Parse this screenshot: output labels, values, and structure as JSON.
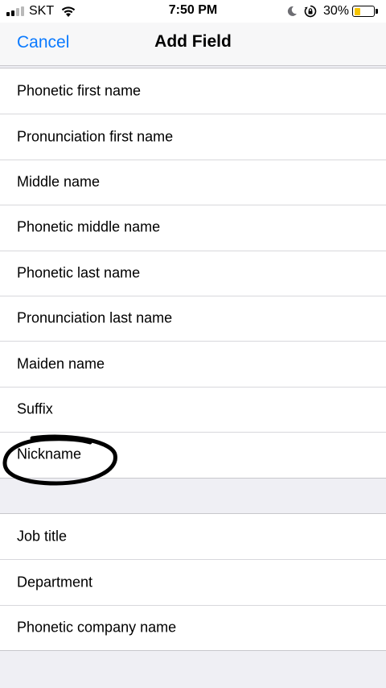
{
  "status_bar": {
    "carrier": "SKT",
    "time": "7:50 PM",
    "battery_percent": "30%",
    "battery_level": 0.3,
    "signal_bars": 2,
    "battery_color": "#f5c400"
  },
  "nav": {
    "cancel_label": "Cancel",
    "title": "Add Field",
    "accent_color": "#0a7aff"
  },
  "name_fields": {
    "items": [
      {
        "label": "Phonetic first name"
      },
      {
        "label": "Pronunciation first name"
      },
      {
        "label": "Middle name"
      },
      {
        "label": "Phonetic middle name"
      },
      {
        "label": "Phonetic last name"
      },
      {
        "label": "Pronunciation last name"
      },
      {
        "label": "Maiden name"
      },
      {
        "label": "Suffix"
      },
      {
        "label": "Nickname",
        "circled": true
      }
    ]
  },
  "work_fields": {
    "items": [
      {
        "label": "Job title"
      },
      {
        "label": "Department"
      },
      {
        "label": "Phonetic company name"
      }
    ]
  }
}
